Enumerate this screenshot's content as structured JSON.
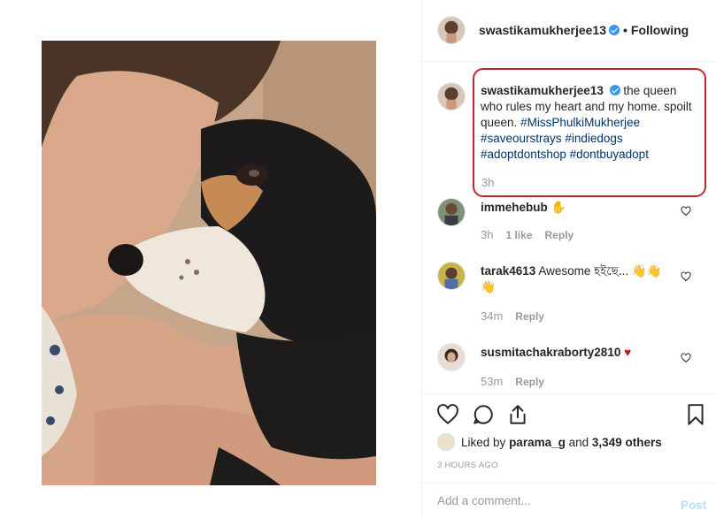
{
  "post": {
    "username": "swastikamukherjee13",
    "follow_status": "Following",
    "separator": "•"
  },
  "caption": {
    "username": "swastikamukherjee13",
    "text": "the queen who rules my heart and my home. spoilt queen.",
    "hashtags": [
      "#MissPhulkiMukherjee",
      "#saveourstrays",
      "#indiedogs",
      "#adoptdontshop",
      "#dontbuyadopt"
    ],
    "time": "3h"
  },
  "comments": [
    {
      "username": "immehebub",
      "text": "✋",
      "time": "3h",
      "likes": "1 like",
      "reply": "Reply"
    },
    {
      "username": "tarak4613",
      "text": "Awesome হইছে... 👋👋👋",
      "time": "34m",
      "likes": "",
      "reply": "Reply"
    },
    {
      "username": "susmitachakraborty2810",
      "text": "♥",
      "time": "53m",
      "likes": "",
      "reply": "Reply"
    }
  ],
  "likes": {
    "prefix": "Liked by",
    "user": "parama_g",
    "joiner": "and",
    "others": "3,349 others"
  },
  "timestamp": "3 HOURS AGO",
  "add_comment": {
    "placeholder": "Add a comment...",
    "post_label": "Post"
  },
  "colors": {
    "highlight_box": "#c0272d",
    "verified": "#3897f0",
    "hashtag": "#003569",
    "muted": "#999999",
    "post_button": "#b2dffc"
  }
}
